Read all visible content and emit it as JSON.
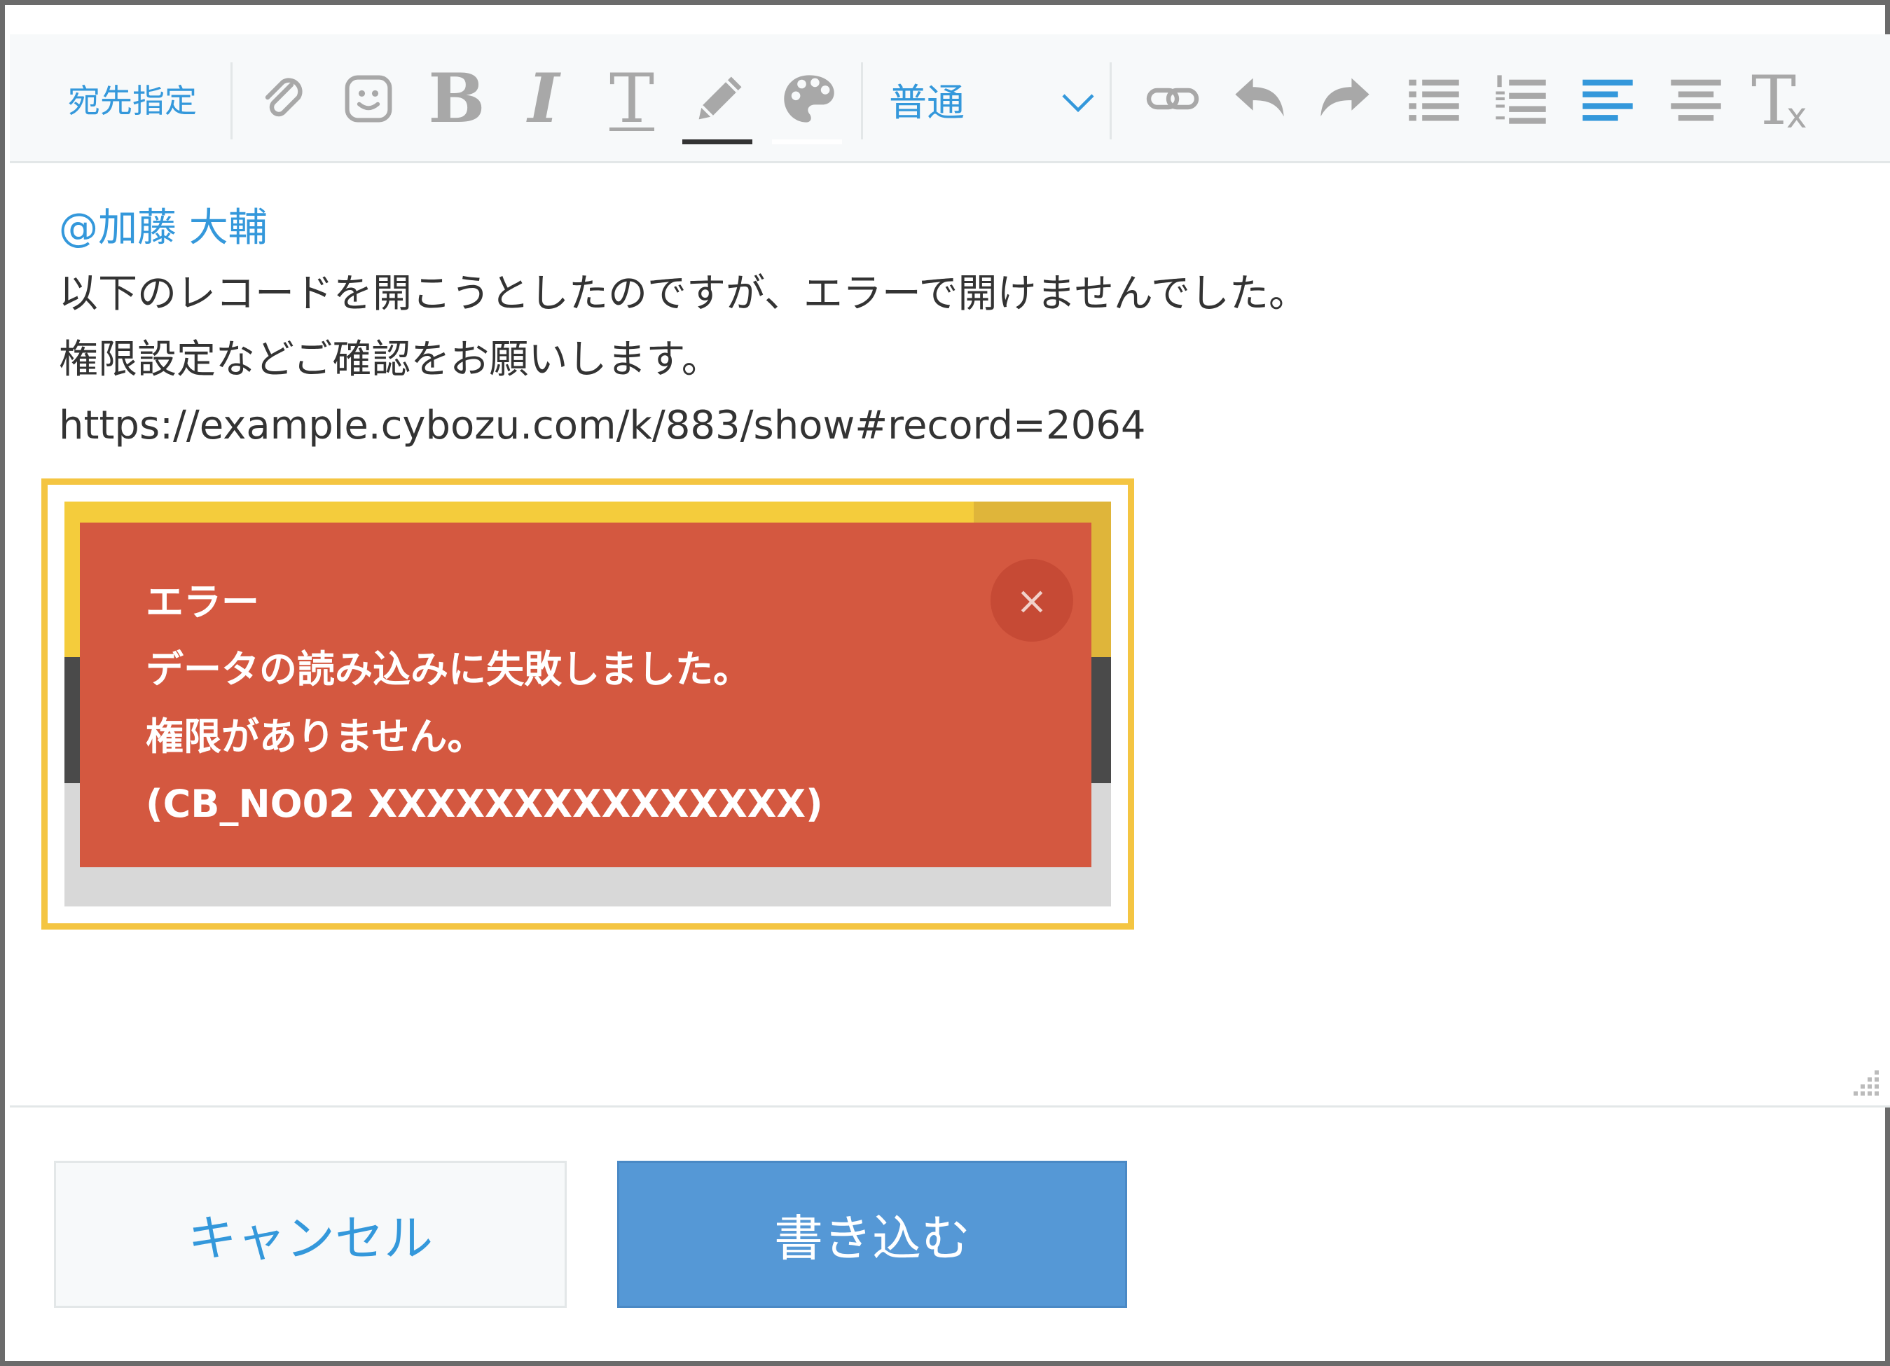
{
  "toolbar": {
    "recipient_label": "宛先指定",
    "bold_glyph": "B",
    "italic_glyph": "I",
    "text_size_glyph": "T",
    "font_size_value": "普通",
    "clear_format_glyph": "T",
    "clear_format_sub": "x"
  },
  "editor": {
    "mention": "@加藤 大輔",
    "lines": [
      "以下のレコードを開こうとしたのですが、エラーで開けませんでした。",
      "権限設定などご確認をお願いします。",
      "https://example.cybozu.com/k/883/show#record=2064"
    ]
  },
  "error_screenshot": {
    "lines": [
      "エラー",
      "データの読み込みに失敗しました。",
      "権限がありません。",
      "(CB_NO02 XXXXXXXXXXXXXXX)"
    ],
    "close_glyph": "×"
  },
  "footer": {
    "cancel_label": "キャンセル",
    "submit_label": "書き込む"
  },
  "colors": {
    "accent_blue": "#3498db",
    "submit_button": "#5598d6",
    "error_red": "#d45840",
    "highlight_yellow": "#f4c542"
  }
}
